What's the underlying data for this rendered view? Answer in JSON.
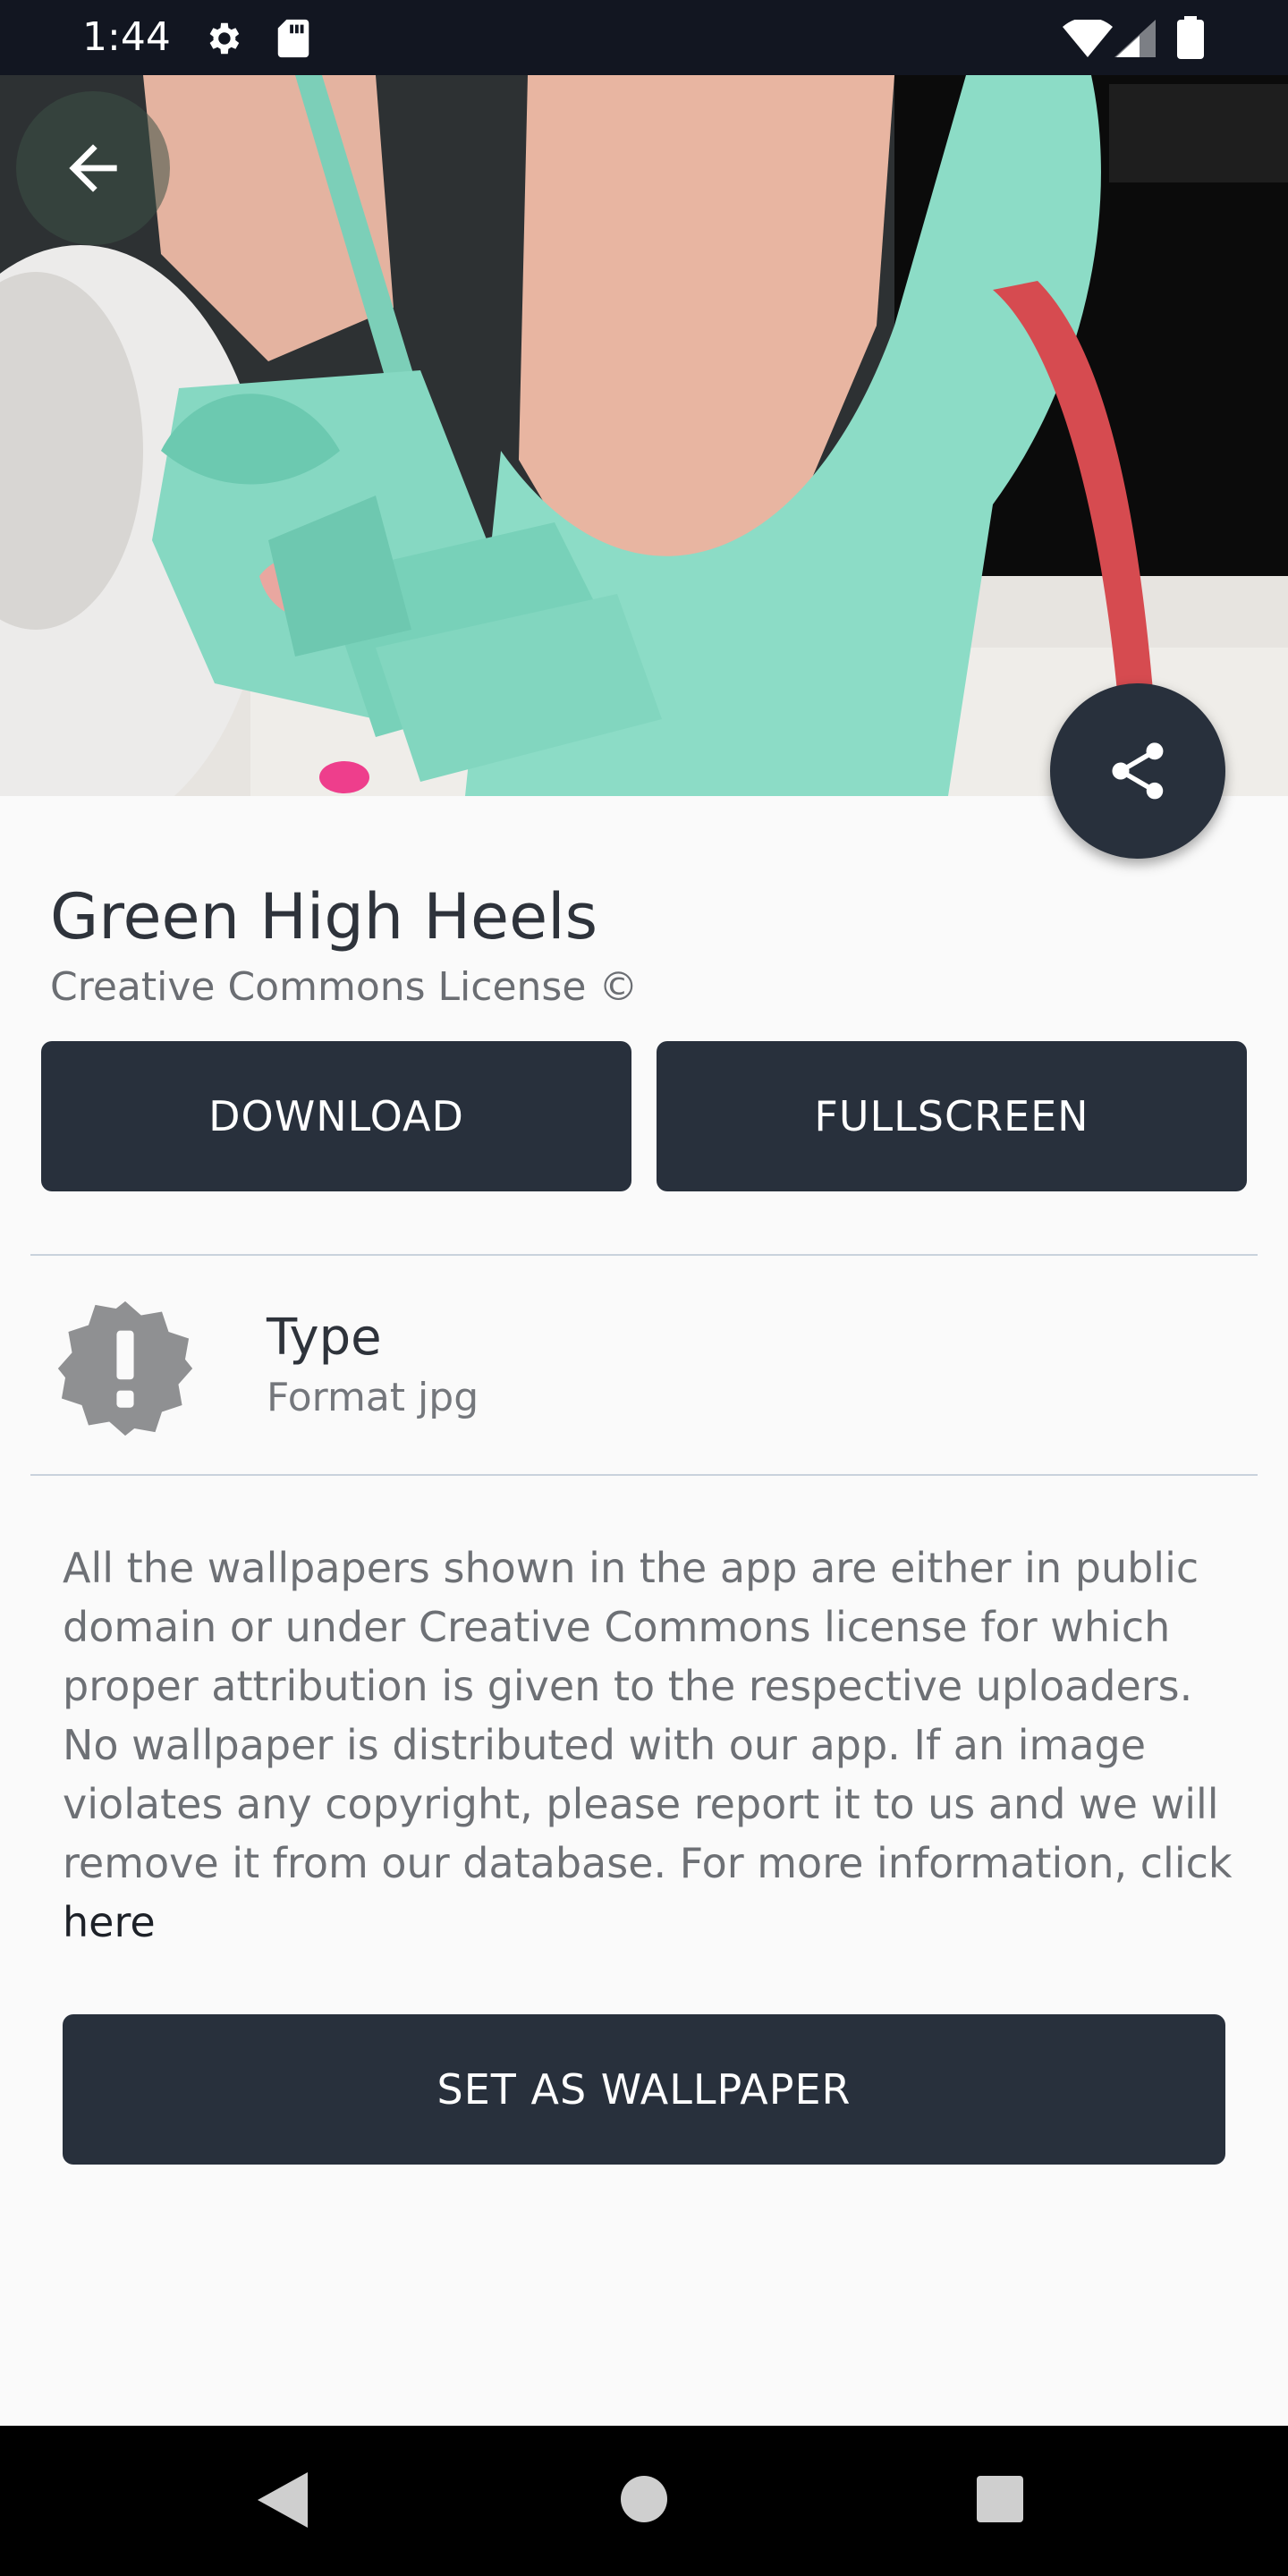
{
  "status_bar": {
    "time": "1:44"
  },
  "hero": {
    "image_description": "green-suede-high-heel-shoe-image"
  },
  "wallpaper": {
    "title": "Green High Heels",
    "license": "Creative Commons License ©"
  },
  "actions": {
    "download_label": "DOWNLOAD",
    "fullscreen_label": "FULLSCREEN",
    "set_wallpaper_label": "SET AS WALLPAPER"
  },
  "details": {
    "type_label": "Type",
    "type_value": "Format jpg"
  },
  "disclaimer": {
    "text": "All the wallpapers shown in the app are either in public domain or under Creative Commons license for which proper attribution is given to the respective uploaders. No wallpaper is distributed with our app. If an image violates any copyright, please report it to us and we will remove it from our database. For more information, click ",
    "link_text": "here"
  },
  "colors": {
    "primary_dark": "#28303c",
    "status_bar": "#121621",
    "background": "#fafafa"
  }
}
